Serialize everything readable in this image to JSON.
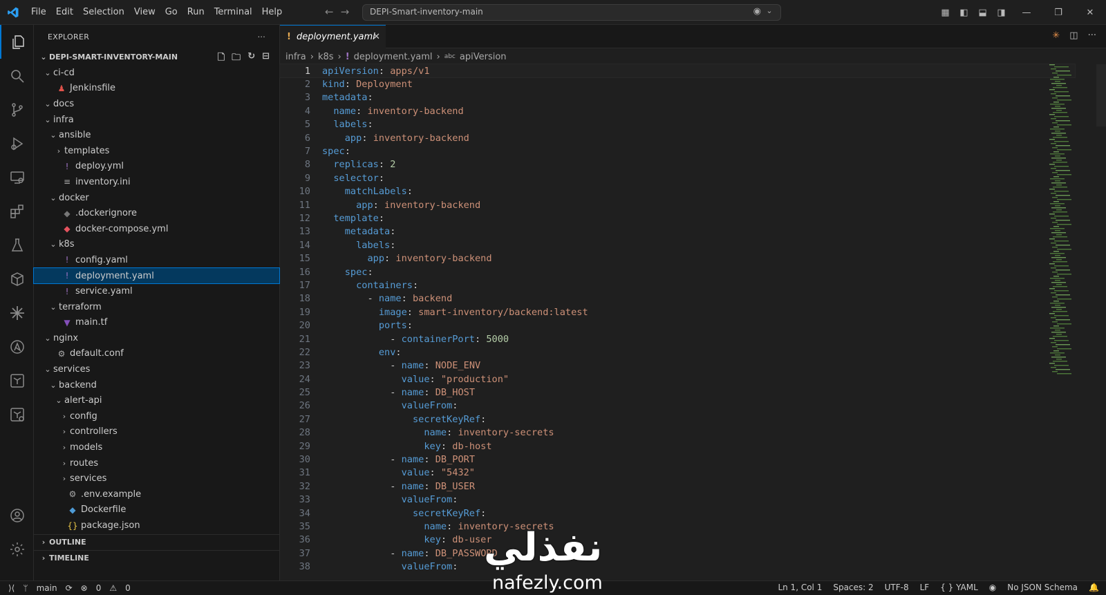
{
  "menu": [
    "File",
    "Edit",
    "Selection",
    "View",
    "Go",
    "Run",
    "Terminal",
    "Help"
  ],
  "command_center": "DEPI-Smart-inventory-main",
  "explorer": {
    "title": "EXPLORER",
    "root": "DEPI-SMART-INVENTORY-MAIN",
    "tree": [
      {
        "label": "ci-cd",
        "depth": 0,
        "type": "folder",
        "open": true
      },
      {
        "label": "Jenkinsfile",
        "depth": 1,
        "type": "file",
        "icon": "jenkins-icon",
        "color": "#e0524a",
        "glyph": "♟"
      },
      {
        "label": "docs",
        "depth": 0,
        "type": "folder",
        "open": true
      },
      {
        "label": "infra",
        "depth": 0,
        "type": "folder",
        "open": true
      },
      {
        "label": "ansible",
        "depth": 1,
        "type": "folder",
        "open": true
      },
      {
        "label": "templates",
        "depth": 2,
        "type": "folder",
        "open": false
      },
      {
        "label": "deploy.yml",
        "depth": 2,
        "type": "file",
        "icon": "yaml-icon",
        "color": "#a074c4",
        "glyph": "!"
      },
      {
        "label": "inventory.ini",
        "depth": 2,
        "type": "file",
        "icon": "ini-icon",
        "color": "#aaaaaa",
        "glyph": "≡"
      },
      {
        "label": "docker",
        "depth": 1,
        "type": "folder",
        "open": true
      },
      {
        "label": ".dockerignore",
        "depth": 2,
        "type": "file",
        "icon": "docker-icon",
        "color": "#777777",
        "glyph": "◆"
      },
      {
        "label": "docker-compose.yml",
        "depth": 2,
        "type": "file",
        "icon": "docker-compose-icon",
        "color": "#e5535f",
        "glyph": "◆"
      },
      {
        "label": "k8s",
        "depth": 1,
        "type": "folder",
        "open": true
      },
      {
        "label": "config.yaml",
        "depth": 2,
        "type": "file",
        "icon": "yaml-icon",
        "color": "#a074c4",
        "glyph": "!"
      },
      {
        "label": "deployment.yaml",
        "depth": 2,
        "type": "file",
        "icon": "yaml-icon",
        "color": "#a074c4",
        "glyph": "!",
        "selected": true
      },
      {
        "label": "service.yaml",
        "depth": 2,
        "type": "file",
        "icon": "yaml-icon",
        "color": "#a074c4",
        "glyph": "!"
      },
      {
        "label": "terraform",
        "depth": 1,
        "type": "folder",
        "open": true
      },
      {
        "label": "main.tf",
        "depth": 2,
        "type": "file",
        "icon": "terraform-icon",
        "color": "#844fba",
        "glyph": "▼"
      },
      {
        "label": "nginx",
        "depth": 0,
        "type": "folder",
        "open": true
      },
      {
        "label": "default.conf",
        "depth": 1,
        "type": "file",
        "icon": "gear-icon",
        "color": "#aaaaaa",
        "glyph": "⚙"
      },
      {
        "label": "services",
        "depth": 0,
        "type": "folder",
        "open": true
      },
      {
        "label": "backend",
        "depth": 1,
        "type": "folder",
        "open": true
      },
      {
        "label": "alert-api",
        "depth": 2,
        "type": "folder",
        "open": true
      },
      {
        "label": "config",
        "depth": 3,
        "type": "folder",
        "open": false
      },
      {
        "label": "controllers",
        "depth": 3,
        "type": "folder",
        "open": false
      },
      {
        "label": "models",
        "depth": 3,
        "type": "folder",
        "open": false
      },
      {
        "label": "routes",
        "depth": 3,
        "type": "folder",
        "open": false
      },
      {
        "label": "services",
        "depth": 3,
        "type": "folder",
        "open": false
      },
      {
        "label": ".env.example",
        "depth": 3,
        "type": "file",
        "icon": "gear-icon",
        "color": "#aaaaaa",
        "glyph": "⚙"
      },
      {
        "label": "Dockerfile",
        "depth": 3,
        "type": "file",
        "icon": "docker-icon",
        "color": "#4e9bd6",
        "glyph": "◆"
      },
      {
        "label": "package.json",
        "depth": 3,
        "type": "file",
        "icon": "json-icon",
        "color": "#e8c547",
        "glyph": "{}"
      }
    ],
    "sections": [
      "OUTLINE",
      "TIMELINE"
    ]
  },
  "tab": {
    "label": "deployment.yaml"
  },
  "breadcrumbs": [
    "infra",
    "k8s",
    "deployment.yaml",
    "apiVersion"
  ],
  "code": [
    [
      [
        "k",
        "apiVersion"
      ],
      [
        "p",
        ": "
      ],
      [
        "v",
        "apps/v1"
      ]
    ],
    [
      [
        "k",
        "kind"
      ],
      [
        "p",
        ": "
      ],
      [
        "v",
        "Deployment"
      ]
    ],
    [
      [
        "k",
        "metadata"
      ],
      [
        "p",
        ":"
      ]
    ],
    [
      [
        "s",
        "  "
      ],
      [
        "k",
        "name"
      ],
      [
        "p",
        ": "
      ],
      [
        "v",
        "inventory-backend"
      ]
    ],
    [
      [
        "s",
        "  "
      ],
      [
        "k",
        "labels"
      ],
      [
        "p",
        ":"
      ]
    ],
    [
      [
        "s",
        "    "
      ],
      [
        "k",
        "app"
      ],
      [
        "p",
        ": "
      ],
      [
        "v",
        "inventory-backend"
      ]
    ],
    [
      [
        "k",
        "spec"
      ],
      [
        "p",
        ":"
      ]
    ],
    [
      [
        "s",
        "  "
      ],
      [
        "k",
        "replicas"
      ],
      [
        "p",
        ": "
      ],
      [
        "n",
        "2"
      ]
    ],
    [
      [
        "s",
        "  "
      ],
      [
        "k",
        "selector"
      ],
      [
        "p",
        ":"
      ]
    ],
    [
      [
        "s",
        "    "
      ],
      [
        "k",
        "matchLabels"
      ],
      [
        "p",
        ":"
      ]
    ],
    [
      [
        "s",
        "      "
      ],
      [
        "k",
        "app"
      ],
      [
        "p",
        ": "
      ],
      [
        "v",
        "inventory-backend"
      ]
    ],
    [
      [
        "s",
        "  "
      ],
      [
        "k",
        "template"
      ],
      [
        "p",
        ":"
      ]
    ],
    [
      [
        "s",
        "    "
      ],
      [
        "k",
        "metadata"
      ],
      [
        "p",
        ":"
      ]
    ],
    [
      [
        "s",
        "      "
      ],
      [
        "k",
        "labels"
      ],
      [
        "p",
        ":"
      ]
    ],
    [
      [
        "s",
        "        "
      ],
      [
        "k",
        "app"
      ],
      [
        "p",
        ": "
      ],
      [
        "v",
        "inventory-backend"
      ]
    ],
    [
      [
        "s",
        "    "
      ],
      [
        "k",
        "spec"
      ],
      [
        "p",
        ":"
      ]
    ],
    [
      [
        "s",
        "      "
      ],
      [
        "k",
        "containers"
      ],
      [
        "p",
        ":"
      ]
    ],
    [
      [
        "s",
        "        "
      ],
      [
        "p",
        "- "
      ],
      [
        "k",
        "name"
      ],
      [
        "p",
        ": "
      ],
      [
        "v",
        "backend"
      ]
    ],
    [
      [
        "s",
        "          "
      ],
      [
        "k",
        "image"
      ],
      [
        "p",
        ": "
      ],
      [
        "v",
        "smart-inventory/backend:latest"
      ]
    ],
    [
      [
        "s",
        "          "
      ],
      [
        "k",
        "ports"
      ],
      [
        "p",
        ":"
      ]
    ],
    [
      [
        "s",
        "            "
      ],
      [
        "p",
        "- "
      ],
      [
        "k",
        "containerPort"
      ],
      [
        "p",
        ": "
      ],
      [
        "n",
        "5000"
      ]
    ],
    [
      [
        "s",
        "          "
      ],
      [
        "k",
        "env"
      ],
      [
        "p",
        ":"
      ]
    ],
    [
      [
        "s",
        "            "
      ],
      [
        "p",
        "- "
      ],
      [
        "k",
        "name"
      ],
      [
        "p",
        ": "
      ],
      [
        "v",
        "NODE_ENV"
      ]
    ],
    [
      [
        "s",
        "              "
      ],
      [
        "k",
        "value"
      ],
      [
        "p",
        ": "
      ],
      [
        "v",
        "\"production\""
      ]
    ],
    [
      [
        "s",
        "            "
      ],
      [
        "p",
        "- "
      ],
      [
        "k",
        "name"
      ],
      [
        "p",
        ": "
      ],
      [
        "v",
        "DB_HOST"
      ]
    ],
    [
      [
        "s",
        "              "
      ],
      [
        "k",
        "valueFrom"
      ],
      [
        "p",
        ":"
      ]
    ],
    [
      [
        "s",
        "                "
      ],
      [
        "k",
        "secretKeyRef"
      ],
      [
        "p",
        ":"
      ]
    ],
    [
      [
        "s",
        "                  "
      ],
      [
        "k",
        "name"
      ],
      [
        "p",
        ": "
      ],
      [
        "v",
        "inventory-secrets"
      ]
    ],
    [
      [
        "s",
        "                  "
      ],
      [
        "k",
        "key"
      ],
      [
        "p",
        ": "
      ],
      [
        "v",
        "db-host"
      ]
    ],
    [
      [
        "s",
        "            "
      ],
      [
        "p",
        "- "
      ],
      [
        "k",
        "name"
      ],
      [
        "p",
        ": "
      ],
      [
        "v",
        "DB_PORT"
      ]
    ],
    [
      [
        "s",
        "              "
      ],
      [
        "k",
        "value"
      ],
      [
        "p",
        ": "
      ],
      [
        "v",
        "\"5432\""
      ]
    ],
    [
      [
        "s",
        "            "
      ],
      [
        "p",
        "- "
      ],
      [
        "k",
        "name"
      ],
      [
        "p",
        ": "
      ],
      [
        "v",
        "DB_USER"
      ]
    ],
    [
      [
        "s",
        "              "
      ],
      [
        "k",
        "valueFrom"
      ],
      [
        "p",
        ":"
      ]
    ],
    [
      [
        "s",
        "                "
      ],
      [
        "k",
        "secretKeyRef"
      ],
      [
        "p",
        ":"
      ]
    ],
    [
      [
        "s",
        "                  "
      ],
      [
        "k",
        "name"
      ],
      [
        "p",
        ": "
      ],
      [
        "v",
        "inventory-secrets"
      ]
    ],
    [
      [
        "s",
        "                  "
      ],
      [
        "k",
        "key"
      ],
      [
        "p",
        ": "
      ],
      [
        "v",
        "db-user"
      ]
    ],
    [
      [
        "s",
        "            "
      ],
      [
        "p",
        "- "
      ],
      [
        "k",
        "name"
      ],
      [
        "p",
        ": "
      ],
      [
        "v",
        "DB_PASSWORD"
      ]
    ],
    [
      [
        "s",
        "              "
      ],
      [
        "k",
        "valueFrom"
      ],
      [
        "p",
        ":"
      ]
    ]
  ],
  "status": {
    "branch": "main",
    "errors": "0",
    "warnings": "0",
    "position": "Ln 1, Col 1",
    "spaces": "Spaces: 2",
    "encoding": "UTF-8",
    "eol": "LF",
    "language": "YAML",
    "schema": "No JSON Schema"
  },
  "watermark": {
    "arabic": "نفذلي",
    "url": "nafezly.com"
  },
  "colors": {
    "accent": "#0078d4",
    "key": "#9cdcfe",
    "string": "#ce9178",
    "number": "#b5cea8"
  }
}
